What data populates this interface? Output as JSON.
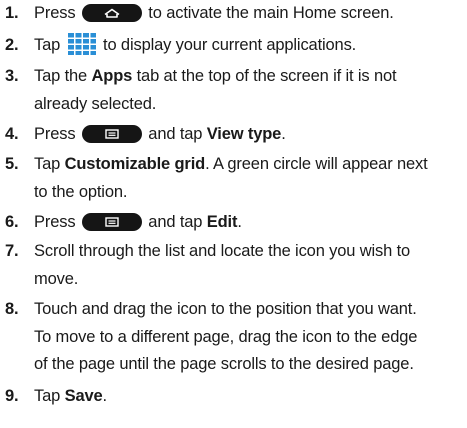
{
  "steps": [
    {
      "num": "1.",
      "before": "Press ",
      "after": " to activate the main Home screen."
    },
    {
      "num": "2.",
      "before": "Tap ",
      "after": " to display your current applications."
    },
    {
      "num": "3.",
      "line1_a": "Tap the ",
      "line1_b": "Apps",
      "line1_c": " tab at the top of the screen if it is not",
      "line2": "already selected."
    },
    {
      "num": "4.",
      "before": "Press ",
      "mid": " and tap ",
      "bold": "View type",
      "after": "."
    },
    {
      "num": "5.",
      "line1_a": "Tap ",
      "line1_b": "Customizable grid",
      "line1_c": ". A green circle will appear next",
      "line2": "to the option."
    },
    {
      "num": "6.",
      "before": "Press ",
      "mid": " and tap ",
      "bold": "Edit",
      "after": "."
    },
    {
      "num": "7.",
      "line1": "Scroll through the list and locate the icon you wish to",
      "line2": "move."
    },
    {
      "num": "8.",
      "line1": "Touch and drag the icon to the position that you want.",
      "line2": "To move to a different page, drag the icon to the edge",
      "line3": "of the page until the page scrolls to the desired page."
    },
    {
      "num": "9.",
      "before": "Tap ",
      "bold": "Save",
      "after": "."
    }
  ],
  "icons": {
    "home_key": "home-key-icon",
    "apps": "apps-grid-icon",
    "menu_key": "menu-key-icon",
    "apps_color": "#2a8fd6",
    "key_color": "#151515"
  }
}
